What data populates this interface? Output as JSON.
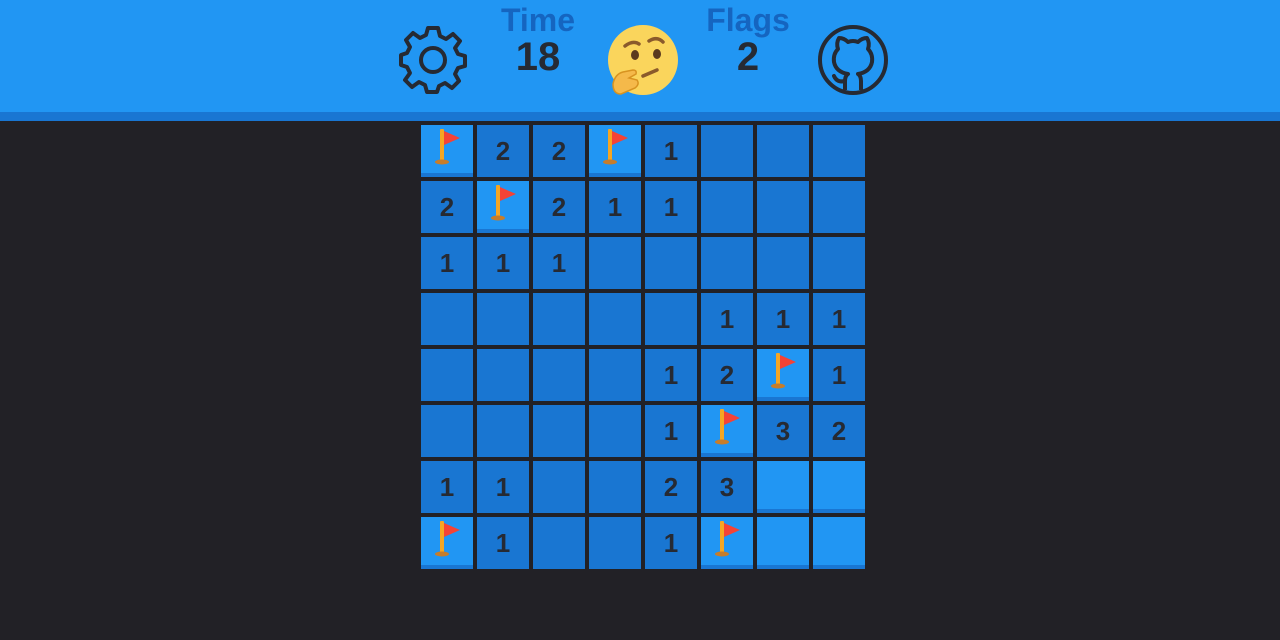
{
  "header": {
    "settings_icon": "gear-icon",
    "time_label": "Time",
    "time_value": "18",
    "face_icon": "thinking-face-icon",
    "flags_label": "Flags",
    "flags_value": "2",
    "github_icon": "github-icon"
  },
  "colors": {
    "header_bg": "#2196f3",
    "header_border": "#1976d2",
    "page_bg": "#222126",
    "cell_revealed": "#1976d2",
    "cell_hidden": "#2196f3",
    "number_text": "#262a33",
    "label_text": "#1565c0",
    "flag_red": "#f44336",
    "flag_pole": "#f5a623"
  },
  "board": {
    "rows": 8,
    "cols": 8,
    "cells": [
      [
        "F",
        "2",
        "2",
        "F",
        "1",
        "",
        "",
        ""
      ],
      [
        "2",
        "F",
        "2",
        "1",
        "1",
        "",
        "",
        ""
      ],
      [
        "1",
        "1",
        "1",
        "",
        "",
        "",
        "",
        ""
      ],
      [
        "",
        "",
        "",
        "",
        "",
        "1",
        "1",
        "1"
      ],
      [
        "",
        "",
        "",
        "",
        "1",
        "2",
        "F",
        "1"
      ],
      [
        "",
        "",
        "",
        "",
        "1",
        "F",
        "3",
        "2"
      ],
      [
        "1",
        "1",
        "",
        "",
        "2",
        "3",
        "H",
        "H"
      ],
      [
        "F",
        "1",
        "",
        "",
        "1",
        "F",
        "H",
        "H"
      ]
    ]
  }
}
